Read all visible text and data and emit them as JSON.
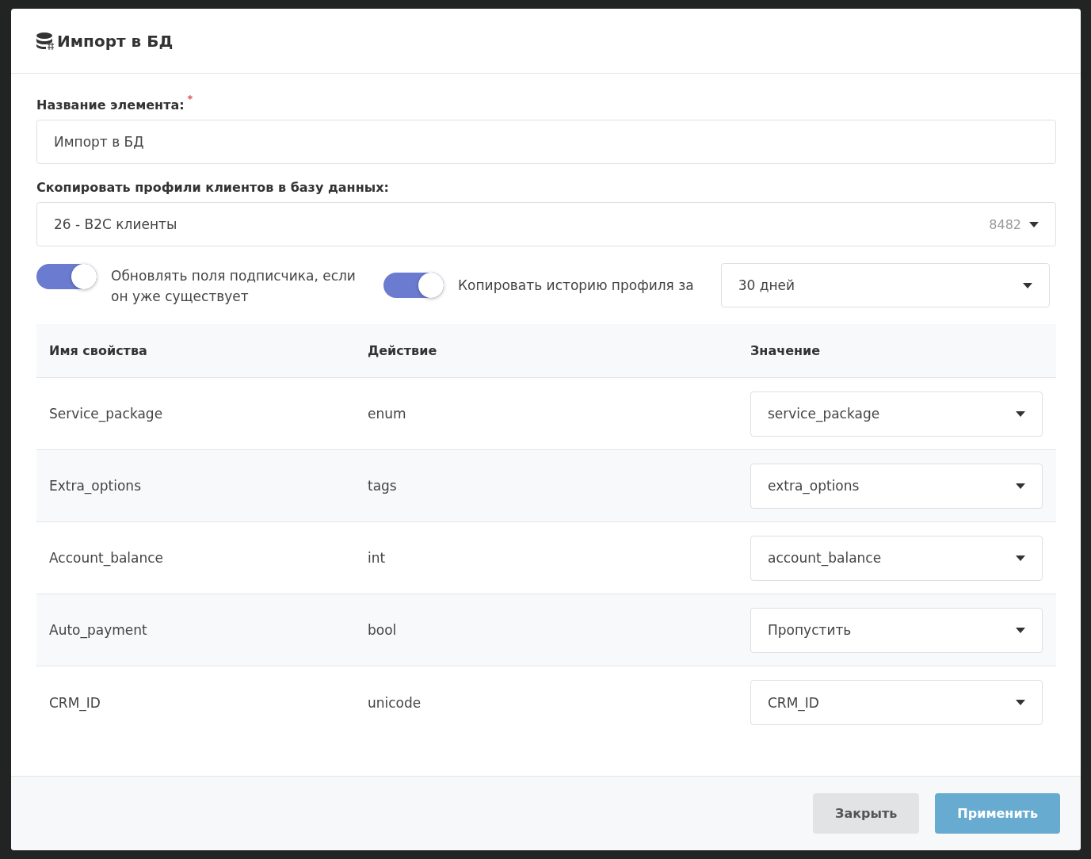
{
  "dialog": {
    "title": "Импорт в БД"
  },
  "name_field": {
    "label": "Название элемента:",
    "required": true,
    "required_mark": "*",
    "value": "Импорт в БД"
  },
  "copy_select": {
    "label": "Скопировать профили клиентов в базу данных:",
    "value": "26 - B2C клиенты",
    "count": "8482"
  },
  "toggles": [
    {
      "label": "Обновлять поля подписчика, если он уже существует",
      "on": true
    },
    {
      "label": "Копировать историю профиля за",
      "on": true
    }
  ],
  "history_select": {
    "value": "30 дней"
  },
  "table": {
    "columns": [
      "Имя свойства",
      "Действие",
      "Значение"
    ],
    "rows": [
      {
        "name": "Service_package",
        "action": "enum",
        "value": "service_package"
      },
      {
        "name": "Extra_options",
        "action": "tags",
        "value": "extra_options"
      },
      {
        "name": "Account_balance",
        "action": "int",
        "value": "account_balance"
      },
      {
        "name": "Auto_payment",
        "action": "bool",
        "value": "Пропустить"
      },
      {
        "name": "CRM_ID",
        "action": "unicode",
        "value": "CRM_ID"
      }
    ]
  },
  "buttons": [
    {
      "label": "Закрыть",
      "kind": "secondary"
    },
    {
      "label": "Применить",
      "kind": "primary"
    }
  ]
}
